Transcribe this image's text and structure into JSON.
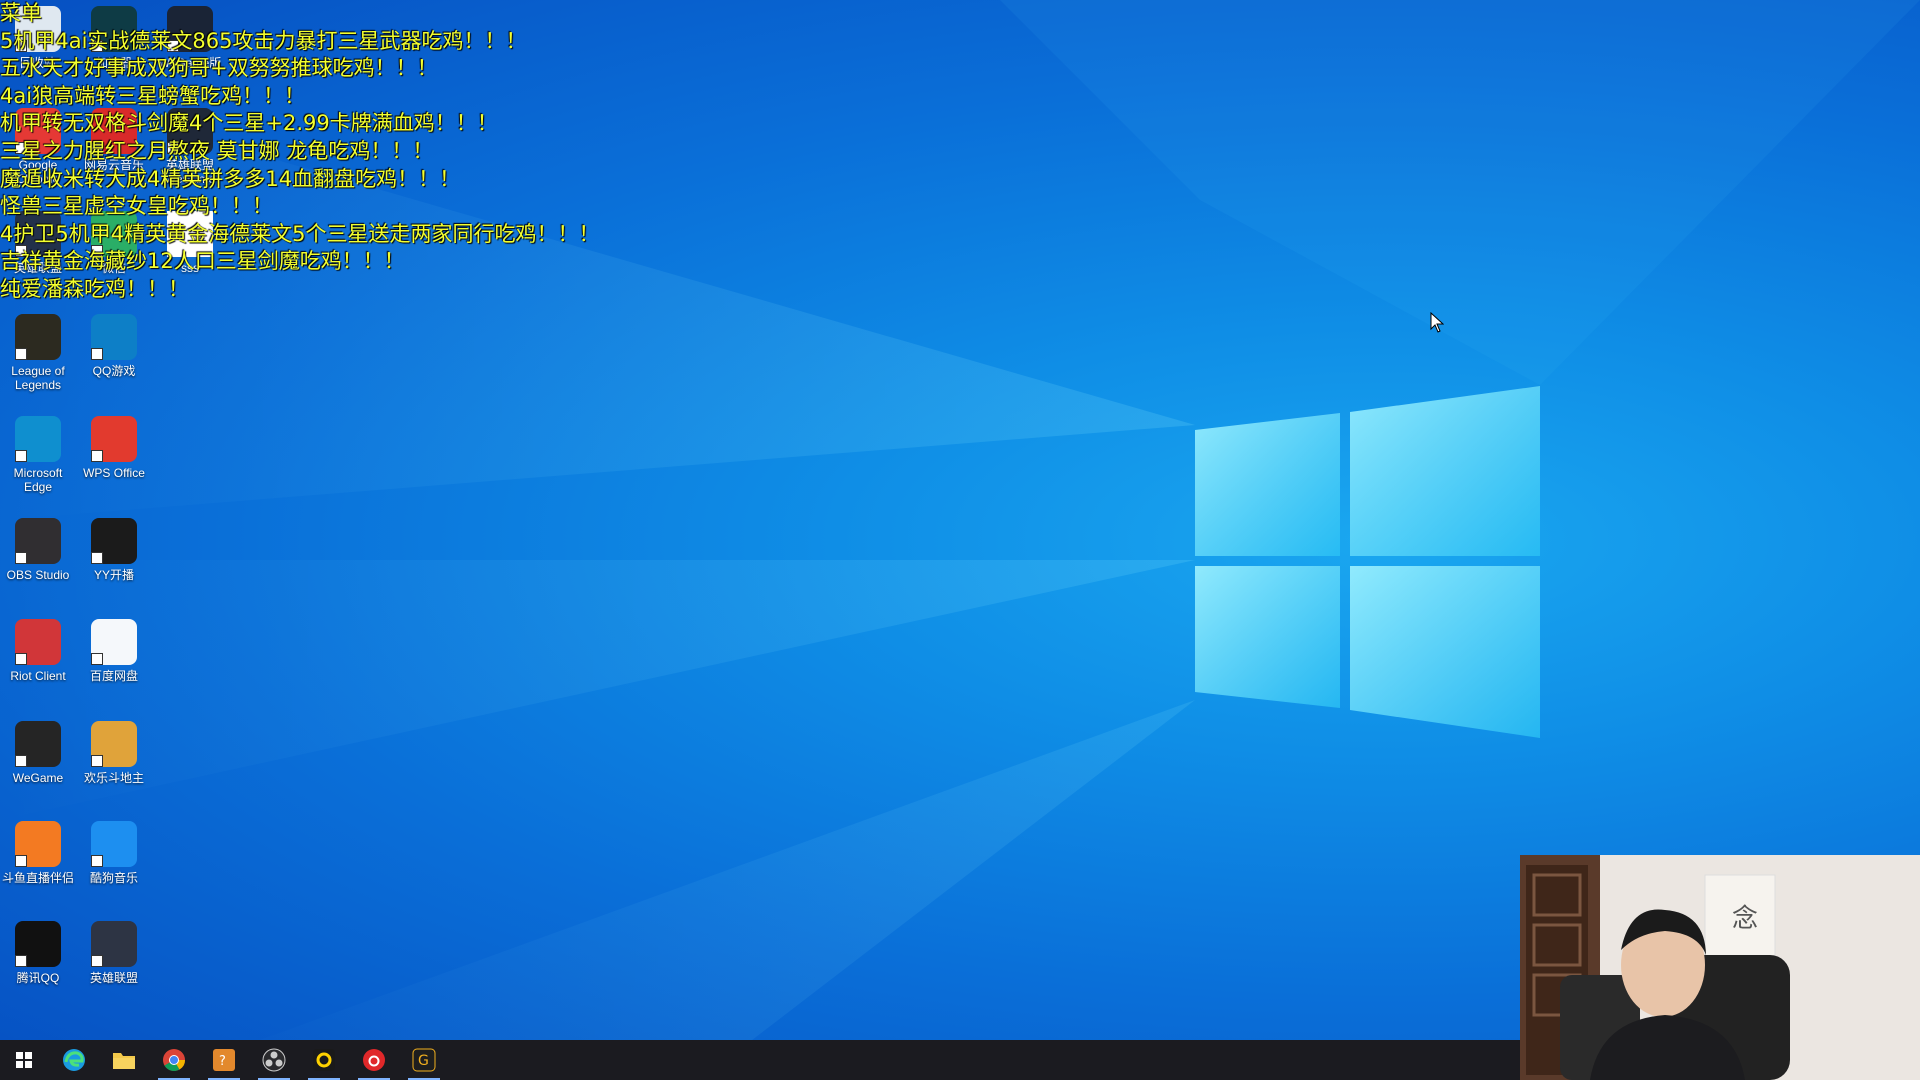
{
  "overlay_lines": [
    "菜单",
    "5机甲4ai实战德莱文865攻击力暴打三星武器吃鸡！！！",
    "五水天才好事成双狗哥+双努努推球吃鸡！！！",
    "4ai狼高端转三星螃蟹吃鸡！！！",
    "机甲转无双格斗剑魔4个三星+2.99卡牌满血鸡！！！",
    "三星之力腥红之月熬夜 莫甘娜 龙龟吃鸡！！！",
    "魔遁收米转大成4精英拼多多14血翻盘吃鸡！！！",
    "怪兽三星虚空女皇吃鸡！！！",
    "4护卫5机甲4精英黄金海德莱文5个三星送走两家同行吃鸡！！！",
    "吉祥黄金海藏纱12人口三星剑魔吃鸡！！！",
    "纯爱潘森吃鸡！！！"
  ],
  "desktop_icons": [
    {
      "label": "回收站",
      "icon": "recycle-bin-icon",
      "color": "#dfe8f0"
    },
    {
      "label": "加速器",
      "icon": "accelerator-icon",
      "color": "#0e3b45"
    },
    {
      "label": "WeGame版",
      "icon": "lol-wegame-icon",
      "color": "#1a2436"
    },
    {
      "label": "Google Chrome",
      "icon": "chrome-icon",
      "color": "#e53935"
    },
    {
      "label": "网易云音乐",
      "icon": "netease-music-icon",
      "color": "#d92a2a"
    },
    {
      "label": "英雄联盟WeGame",
      "icon": "lol-icon",
      "color": "#1f2838"
    },
    {
      "label": "英雄联盟",
      "icon": "lol-small-icon",
      "color": "#23314a"
    },
    {
      "label": "微信",
      "icon": "wechat-icon",
      "color": "#2aae67"
    },
    {
      "label": "sss",
      "icon": "file-icon",
      "color": "#ffffff"
    },
    {
      "label": "League of Legends",
      "icon": "league-icon",
      "color": "#2c2a20"
    },
    {
      "label": "QQ游戏",
      "icon": "qq-game-icon",
      "color": "#0d7fc7"
    },
    {
      "label": "sss",
      "icon": "blank-file-icon",
      "color": "#ffffff"
    },
    {
      "label": "Microsoft Edge",
      "icon": "edge-icon",
      "color": "#0f8fcf"
    },
    {
      "label": "WPS Office",
      "icon": "wps-icon",
      "color": "#e23a2e"
    },
    {
      "label": "OBS Studio",
      "icon": "obs-icon",
      "color": "#302e31"
    },
    {
      "label": "YY开播",
      "icon": "yy-icon",
      "color": "#1b1b1b"
    },
    {
      "label": "Riot Client",
      "icon": "riot-icon",
      "color": "#d13639"
    },
    {
      "label": "百度网盘",
      "icon": "baidu-pan-icon",
      "color": "#f5f8fb"
    },
    {
      "label": "WeGame",
      "icon": "wegame-icon",
      "color": "#252525"
    },
    {
      "label": "欢乐斗地主",
      "icon": "doudizhu-icon",
      "color": "#e0a33a"
    },
    {
      "label": "斗鱼直播伴侣",
      "icon": "douyu-icon",
      "color": "#f37a22"
    },
    {
      "label": "酷狗音乐",
      "icon": "kugou-icon",
      "color": "#1d8ff0"
    },
    {
      "label": "腾讯QQ",
      "icon": "qq-icon",
      "color": "#111111"
    },
    {
      "label": "英雄联盟",
      "icon": "lol-client-icon",
      "color": "#2d3444"
    }
  ],
  "taskbar": [
    {
      "name": "start-button",
      "icon": "windows-icon"
    },
    {
      "name": "taskbar-edge",
      "icon": "edge-icon"
    },
    {
      "name": "taskbar-explorer",
      "icon": "folder-icon"
    },
    {
      "name": "taskbar-chrome",
      "icon": "chrome-icon"
    },
    {
      "name": "taskbar-app-orange",
      "icon": "app-icon"
    },
    {
      "name": "taskbar-obs",
      "icon": "obs-icon"
    },
    {
      "name": "taskbar-yy",
      "icon": "yy-icon"
    },
    {
      "name": "taskbar-netease",
      "icon": "netease-music-icon"
    },
    {
      "name": "taskbar-wegame",
      "icon": "wegame-icon"
    }
  ],
  "colors": {
    "overlay_text": "#f3ff2e",
    "taskbar": "#1b1b20",
    "desktop": "#0a6fd8"
  }
}
